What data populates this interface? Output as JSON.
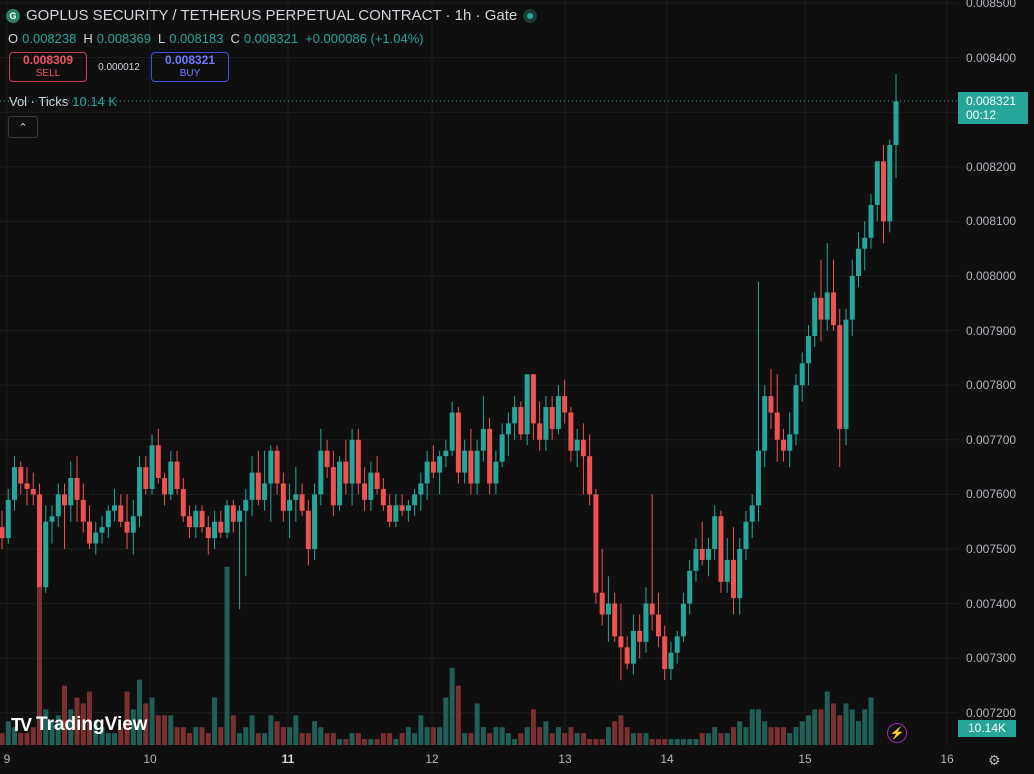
{
  "header": {
    "symbol_icon": "gate-coin-icon",
    "title": "GOPLUS SECURITY / TETHERUS PERPETUAL CONTRACT · 1h · Gate",
    "live_status": "live-dot-icon"
  },
  "ohlc": {
    "o_label": "O",
    "o_value": "0.008238",
    "h_label": "H",
    "h_value": "0.008369",
    "l_label": "L",
    "l_value": "0.008183",
    "c_label": "C",
    "c_value": "0.008321",
    "change": "+0.000086 (+1.04%)"
  },
  "trade": {
    "sell_price": "0.008309",
    "sell_label": "SELL",
    "spread": "0.000012",
    "buy_price": "0.008321",
    "buy_label": "BUY"
  },
  "volume_legend": {
    "label": "Vol · Ticks",
    "value": "10.14 K"
  },
  "collapse_glyph": "⌃",
  "price_axis": {
    "ticks": [
      "0.008500",
      "0.008400",
      "0.008300",
      "0.008200",
      "0.008100",
      "0.008000",
      "0.007900",
      "0.007800",
      "0.007700",
      "0.007600",
      "0.007500",
      "0.007400",
      "0.007300",
      "0.007200"
    ]
  },
  "time_axis": {
    "labels": [
      "9",
      "10",
      "11",
      "12",
      "13",
      "14",
      "15",
      "16"
    ],
    "bold_label": "11"
  },
  "last_price": {
    "value": "0.008321",
    "countdown": "00:12"
  },
  "volume_tag": "10.14K",
  "branding": {
    "logo_mark": "TV",
    "logo_text": "TradingView"
  },
  "settings_icon": "⚙",
  "flash_icon": "⚡",
  "colors": {
    "up": "#26a69a",
    "down": "#ef5350",
    "vol_up": "#1f5f57",
    "vol_down": "#7a2f30",
    "grid": "#1e1e1e"
  },
  "chart_data": {
    "type": "candlestick",
    "ylim": [
      0.00715,
      0.0085
    ],
    "candles": [
      [
        0.00754,
        0.00757,
        0.0075,
        0.00752
      ],
      [
        0.00752,
        0.00761,
        0.00751,
        0.00759
      ],
      [
        0.00759,
        0.00767,
        0.00757,
        0.00765
      ],
      [
        0.00765,
        0.00766,
        0.0076,
        0.00762
      ],
      [
        0.00762,
        0.00765,
        0.00758,
        0.00761
      ],
      [
        0.00761,
        0.00764,
        0.00758,
        0.0076
      ],
      [
        0.0076,
        0.00762,
        0.00743,
        0.00743
      ],
      [
        0.00743,
        0.00758,
        0.00742,
        0.00755
      ],
      [
        0.00755,
        0.00758,
        0.00751,
        0.00756
      ],
      [
        0.00756,
        0.00762,
        0.00754,
        0.0076
      ],
      [
        0.0076,
        0.00762,
        0.0075,
        0.00758
      ],
      [
        0.00758,
        0.00766,
        0.00755,
        0.00763
      ],
      [
        0.00763,
        0.00767,
        0.00755,
        0.00759
      ],
      [
        0.00759,
        0.00762,
        0.00753,
        0.00755
      ],
      [
        0.00755,
        0.00758,
        0.0075,
        0.00751
      ],
      [
        0.00751,
        0.00755,
        0.00749,
        0.00753
      ],
      [
        0.00753,
        0.00756,
        0.00751,
        0.00754
      ],
      [
        0.00754,
        0.00758,
        0.00752,
        0.00757
      ],
      [
        0.00757,
        0.00761,
        0.00755,
        0.00758
      ],
      [
        0.00758,
        0.0076,
        0.00754,
        0.00755
      ],
      [
        0.00755,
        0.0076,
        0.0075,
        0.00753
      ],
      [
        0.00753,
        0.00759,
        0.00749,
        0.00756
      ],
      [
        0.00756,
        0.00767,
        0.00754,
        0.00765
      ],
      [
        0.00765,
        0.00767,
        0.0076,
        0.00761
      ],
      [
        0.00761,
        0.00771,
        0.0076,
        0.00769
      ],
      [
        0.00769,
        0.00772,
        0.00762,
        0.00763
      ],
      [
        0.00763,
        0.00764,
        0.00758,
        0.0076
      ],
      [
        0.0076,
        0.00768,
        0.00759,
        0.00766
      ],
      [
        0.00766,
        0.00768,
        0.0076,
        0.00761
      ],
      [
        0.00761,
        0.00763,
        0.00755,
        0.00756
      ],
      [
        0.00756,
        0.00758,
        0.00752,
        0.00754
      ],
      [
        0.00754,
        0.00758,
        0.00752,
        0.00757
      ],
      [
        0.00757,
        0.00758,
        0.00753,
        0.00754
      ],
      [
        0.00754,
        0.00756,
        0.00749,
        0.00752
      ],
      [
        0.00752,
        0.00757,
        0.0075,
        0.00755
      ],
      [
        0.00755,
        0.00757,
        0.00752,
        0.00753
      ],
      [
        0.00753,
        0.00759,
        0.00752,
        0.00758
      ],
      [
        0.00758,
        0.00759,
        0.00753,
        0.00755
      ],
      [
        0.00755,
        0.00758,
        0.00739,
        0.00757
      ],
      [
        0.00757,
        0.00761,
        0.00745,
        0.00759
      ],
      [
        0.00759,
        0.00767,
        0.00756,
        0.00764
      ],
      [
        0.00764,
        0.00768,
        0.00758,
        0.00759
      ],
      [
        0.00759,
        0.00768,
        0.00757,
        0.00762
      ],
      [
        0.00762,
        0.00769,
        0.00755,
        0.00768
      ],
      [
        0.00768,
        0.00769,
        0.0076,
        0.00762
      ],
      [
        0.00762,
        0.00764,
        0.00755,
        0.00757
      ],
      [
        0.00757,
        0.00762,
        0.00752,
        0.00759
      ],
      [
        0.00759,
        0.00765,
        0.00755,
        0.0076
      ],
      [
        0.0076,
        0.00762,
        0.00756,
        0.00757
      ],
      [
        0.00757,
        0.00759,
        0.00747,
        0.0075
      ],
      [
        0.0075,
        0.00762,
        0.00748,
        0.0076
      ],
      [
        0.0076,
        0.00772,
        0.00758,
        0.00768
      ],
      [
        0.00768,
        0.0077,
        0.00763,
        0.00765
      ],
      [
        0.00765,
        0.00768,
        0.00756,
        0.00758
      ],
      [
        0.00758,
        0.00767,
        0.00757,
        0.00766
      ],
      [
        0.00766,
        0.0077,
        0.0076,
        0.00762
      ],
      [
        0.00762,
        0.00772,
        0.00758,
        0.0077
      ],
      [
        0.0077,
        0.00772,
        0.0076,
        0.00762
      ],
      [
        0.00762,
        0.00765,
        0.00757,
        0.00759
      ],
      [
        0.00759,
        0.00766,
        0.00757,
        0.00764
      ],
      [
        0.00764,
        0.00767,
        0.0076,
        0.00761
      ],
      [
        0.00761,
        0.00763,
        0.00757,
        0.00758
      ],
      [
        0.00758,
        0.0076,
        0.00754,
        0.00755
      ],
      [
        0.00755,
        0.0076,
        0.00754,
        0.00758
      ],
      [
        0.00758,
        0.0076,
        0.00756,
        0.00757
      ],
      [
        0.00757,
        0.00759,
        0.00755,
        0.00758
      ],
      [
        0.00758,
        0.00761,
        0.00756,
        0.0076
      ],
      [
        0.0076,
        0.00764,
        0.00757,
        0.00762
      ],
      [
        0.00762,
        0.00768,
        0.00759,
        0.00766
      ],
      [
        0.00766,
        0.00769,
        0.00763,
        0.00764
      ],
      [
        0.00764,
        0.00768,
        0.0076,
        0.00767
      ],
      [
        0.00767,
        0.0077,
        0.00765,
        0.00768
      ],
      [
        0.00768,
        0.00777,
        0.00767,
        0.00775
      ],
      [
        0.00775,
        0.00776,
        0.00762,
        0.00764
      ],
      [
        0.00764,
        0.0077,
        0.00762,
        0.00768
      ],
      [
        0.00768,
        0.00772,
        0.0076,
        0.00762
      ],
      [
        0.00762,
        0.0077,
        0.0076,
        0.00768
      ],
      [
        0.00768,
        0.00778,
        0.00766,
        0.00772
      ],
      [
        0.00772,
        0.00774,
        0.0076,
        0.00762
      ],
      [
        0.00762,
        0.00768,
        0.0076,
        0.00766
      ],
      [
        0.00766,
        0.00773,
        0.00765,
        0.00771
      ],
      [
        0.00771,
        0.00775,
        0.00767,
        0.00773
      ],
      [
        0.00773,
        0.00778,
        0.0077,
        0.00776
      ],
      [
        0.00776,
        0.00777,
        0.0077,
        0.00771
      ],
      [
        0.00771,
        0.00782,
        0.00769,
        0.00782
      ],
      [
        0.00782,
        0.00782,
        0.0077,
        0.00773
      ],
      [
        0.00773,
        0.00777,
        0.00768,
        0.0077
      ],
      [
        0.0077,
        0.00778,
        0.00768,
        0.00776
      ],
      [
        0.00776,
        0.00778,
        0.0077,
        0.00772
      ],
      [
        0.00772,
        0.0078,
        0.00771,
        0.00778
      ],
      [
        0.00778,
        0.00781,
        0.00773,
        0.00775
      ],
      [
        0.00775,
        0.00776,
        0.00766,
        0.00768
      ],
      [
        0.00768,
        0.00772,
        0.00765,
        0.0077
      ],
      [
        0.0077,
        0.00773,
        0.0076,
        0.00767
      ],
      [
        0.00767,
        0.00771,
        0.00758,
        0.0076
      ],
      [
        0.0076,
        0.00761,
        0.0074,
        0.00742
      ],
      [
        0.00742,
        0.0075,
        0.00736,
        0.00738
      ],
      [
        0.00738,
        0.00745,
        0.00733,
        0.0074
      ],
      [
        0.0074,
        0.00742,
        0.00733,
        0.00734
      ],
      [
        0.00734,
        0.0074,
        0.00726,
        0.00732
      ],
      [
        0.00732,
        0.00734,
        0.00728,
        0.00729
      ],
      [
        0.00729,
        0.00738,
        0.00727,
        0.00735
      ],
      [
        0.00735,
        0.00738,
        0.0073,
        0.00733
      ],
      [
        0.00733,
        0.00743,
        0.00731,
        0.0074
      ],
      [
        0.0074,
        0.0076,
        0.00735,
        0.00738
      ],
      [
        0.00738,
        0.00742,
        0.00732,
        0.00734
      ],
      [
        0.00734,
        0.00736,
        0.00726,
        0.00728
      ],
      [
        0.00728,
        0.00733,
        0.00726,
        0.00731
      ],
      [
        0.00731,
        0.00735,
        0.00729,
        0.00734
      ],
      [
        0.00734,
        0.00742,
        0.00733,
        0.0074
      ],
      [
        0.0074,
        0.00748,
        0.00738,
        0.00746
      ],
      [
        0.00746,
        0.00752,
        0.00744,
        0.0075
      ],
      [
        0.0075,
        0.00755,
        0.00747,
        0.00748
      ],
      [
        0.00748,
        0.00752,
        0.00745,
        0.0075
      ],
      [
        0.0075,
        0.00758,
        0.00748,
        0.00756
      ],
      [
        0.00756,
        0.00757,
        0.00742,
        0.00744
      ],
      [
        0.00744,
        0.00752,
        0.00742,
        0.00748
      ],
      [
        0.00748,
        0.00754,
        0.00738,
        0.00741
      ],
      [
        0.00741,
        0.00752,
        0.00738,
        0.0075
      ],
      [
        0.0075,
        0.00757,
        0.00748,
        0.00755
      ],
      [
        0.00755,
        0.0076,
        0.00752,
        0.00758
      ],
      [
        0.00758,
        0.00799,
        0.00755,
        0.00768
      ],
      [
        0.00768,
        0.0078,
        0.00765,
        0.00778
      ],
      [
        0.00778,
        0.00783,
        0.00772,
        0.00775
      ],
      [
        0.00775,
        0.00782,
        0.00766,
        0.0077
      ],
      [
        0.0077,
        0.00772,
        0.00766,
        0.00768
      ],
      [
        0.00768,
        0.00775,
        0.00765,
        0.00771
      ],
      [
        0.00771,
        0.00782,
        0.00769,
        0.0078
      ],
      [
        0.0078,
        0.00786,
        0.00777,
        0.00784
      ],
      [
        0.00784,
        0.00791,
        0.0078,
        0.00789
      ],
      [
        0.00789,
        0.00797,
        0.00787,
        0.00796
      ],
      [
        0.00796,
        0.00803,
        0.00788,
        0.00792
      ],
      [
        0.00792,
        0.00806,
        0.0079,
        0.00797
      ],
      [
        0.00797,
        0.00803,
        0.0079,
        0.00791
      ],
      [
        0.00791,
        0.00794,
        0.00765,
        0.00772
      ],
      [
        0.00772,
        0.00794,
        0.00769,
        0.00792
      ],
      [
        0.00792,
        0.00803,
        0.00789,
        0.008
      ],
      [
        0.008,
        0.00808,
        0.00798,
        0.00805
      ],
      [
        0.00805,
        0.0081,
        0.00801,
        0.00807
      ],
      [
        0.00807,
        0.00815,
        0.00805,
        0.00813
      ],
      [
        0.00813,
        0.00821,
        0.0081,
        0.00821
      ],
      [
        0.00821,
        0.00824,
        0.00806,
        0.0081
      ],
      [
        0.0081,
        0.00825,
        0.00808,
        0.00824
      ],
      [
        0.00824,
        0.00837,
        0.00818,
        0.00832
      ]
    ],
    "volumes": [
      0.2,
      0.4,
      0.3,
      0.2,
      0.2,
      0.3,
      3.1,
      0.6,
      0.4,
      0.5,
      1.0,
      0.6,
      0.8,
      0.7,
      0.9,
      0.4,
      0.3,
      0.2,
      0.2,
      0.3,
      0.9,
      0.6,
      1.1,
      0.7,
      0.8,
      0.5,
      0.5,
      0.5,
      0.3,
      0.3,
      0.2,
      0.3,
      0.3,
      0.2,
      0.8,
      0.3,
      3.0,
      0.5,
      0.2,
      0.3,
      0.5,
      0.2,
      0.2,
      0.5,
      0.4,
      0.3,
      0.3,
      0.5,
      0.2,
      0.2,
      0.4,
      0.3,
      0.2,
      0.2,
      0.1,
      0.1,
      0.2,
      0.2,
      0.1,
      0.1,
      0.1,
      0.2,
      0.2,
      0.1,
      0.2,
      0.3,
      0.2,
      0.5,
      0.3,
      0.3,
      0.3,
      0.8,
      1.3,
      1.0,
      0.2,
      0.2,
      0.7,
      0.3,
      0.2,
      0.3,
      0.3,
      0.2,
      0.1,
      0.2,
      0.3,
      0.6,
      0.3,
      0.4,
      0.2,
      0.3,
      0.2,
      0.3,
      0.2,
      0.2,
      0.1,
      0.1,
      0.1,
      0.3,
      0.4,
      0.5,
      0.3,
      0.2,
      0.2,
      0.2,
      0.1,
      0.1,
      0.1,
      0.1,
      0.1,
      0.1,
      0.1,
      0.1,
      0.2,
      0.2,
      0.3,
      0.2,
      0.2,
      0.3,
      0.4,
      0.3,
      0.6,
      0.6,
      0.4,
      0.3,
      0.3,
      0.3,
      0.2,
      0.3,
      0.4,
      0.5,
      0.6,
      0.6,
      0.9,
      0.7,
      0.5,
      0.7,
      0.6,
      0.4,
      0.6,
      0.8
    ]
  }
}
